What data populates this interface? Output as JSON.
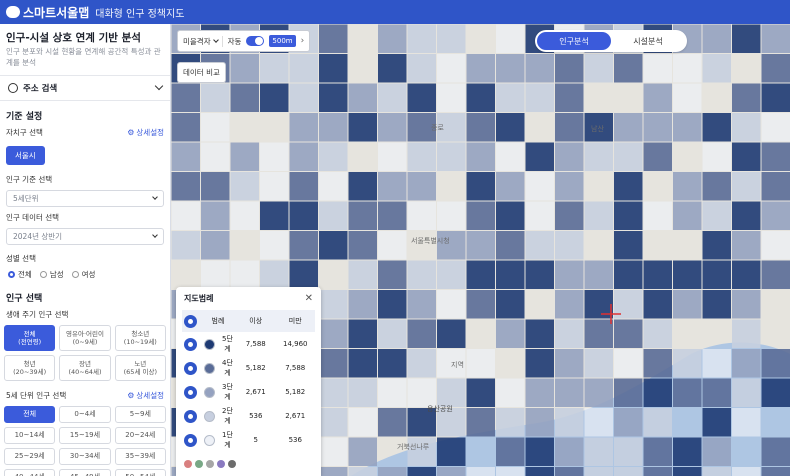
{
  "header": {
    "logo": "스마트서울맵",
    "subtitle": "대화형 인구 정책지도"
  },
  "sidebar": {
    "title": "인구-시설 상호 연계 기반 분석",
    "desc": "인구 분포와 시설 현황을 연계해 공간적 특성과 관계를 분석",
    "address_search": "주소 검색",
    "basic_settings": "기준 설정",
    "district_label": "자치구 선택",
    "detail_link": "상세설정",
    "district_value": "서울시",
    "pop_basis_label": "인구 기준 선택",
    "pop_basis_value": "5세단위",
    "pop_data_label": "인구 데이터 선택",
    "pop_data_value": "2024년 상반기",
    "gender_label": "성별 선택",
    "gender_options": [
      "전체",
      "남성",
      "여성"
    ],
    "pop_select_title": "인구 선택",
    "lifecycle_label": "생애 주기 인구 선택",
    "lifecycle": [
      [
        "전체",
        "(전연령)"
      ],
      [
        "영유아·어린이",
        "(0~9세)"
      ],
      [
        "청소년",
        "(10~19세)"
      ],
      [
        "청년",
        "(20~39세)"
      ],
      [
        "장년",
        "(40~64세)"
      ],
      [
        "노년",
        "(65세 이상)"
      ]
    ],
    "age5_label": "5세 단위 인구 선택",
    "age5": [
      "전체",
      "0~4세",
      "5~9세",
      "10~14세",
      "15~19세",
      "20~24세",
      "25~29세",
      "30~34세",
      "35~39세",
      "40~44세",
      "45~49세",
      "50~54세"
    ]
  },
  "map": {
    "unit": "미을격자",
    "auto_label": "자동",
    "size_badge": "500m",
    "compare": "데이터 비교",
    "tabs": [
      "인구분석",
      "시설분석"
    ],
    "labels": [
      "서울특별시청",
      "용산공원",
      "지역",
      "거북선나루",
      "한강",
      "종로",
      "남산"
    ]
  },
  "legend": {
    "title": "지도범례",
    "headers": [
      "범례",
      "이상",
      "미만"
    ],
    "rows": [
      {
        "level": "5단계",
        "min": "7,588",
        "max": "14,960",
        "color": "#1e3a73"
      },
      {
        "level": "4단계",
        "min": "5,182",
        "max": "7,588",
        "color": "#5a6c97"
      },
      {
        "level": "3단계",
        "min": "2,671",
        "max": "5,182",
        "color": "#95a2c0"
      },
      {
        "level": "2단계",
        "min": "536",
        "max": "2,671",
        "color": "#c7cfdf"
      },
      {
        "level": "1단계",
        "min": "5",
        "max": "536",
        "color": "#eef1f7"
      }
    ],
    "swatches": [
      "#d98080",
      "#79a886",
      "#a6a6a6",
      "#8a7ac0",
      "#6c6c6c"
    ]
  },
  "colors": {
    "accent": "#3b5bdb",
    "header": "#2f55c8"
  }
}
